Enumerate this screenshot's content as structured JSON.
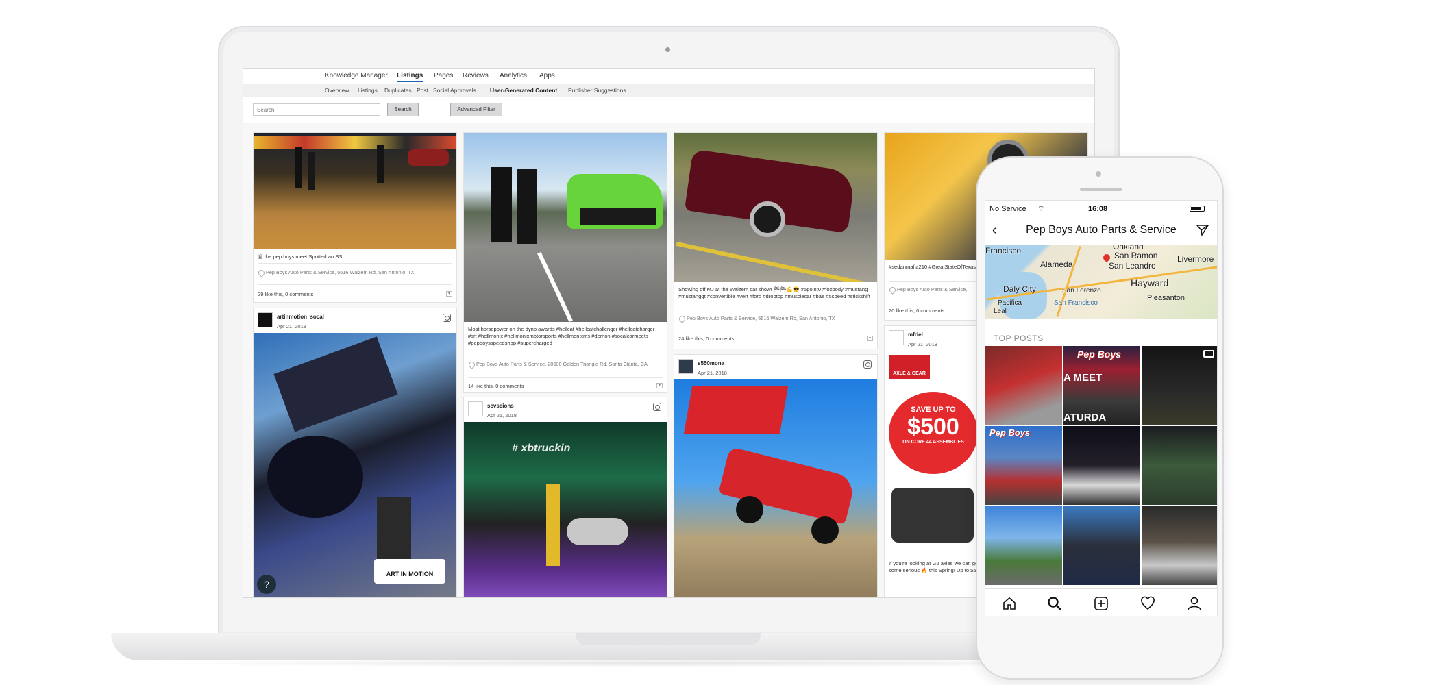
{
  "laptop": {
    "topnav": [
      "Knowledge Manager",
      "Listings",
      "Pages",
      "Reviews",
      "Analytics",
      "Apps"
    ],
    "subnav": [
      "Overview",
      "Listings",
      "Duplicates",
      "Post",
      "Social Approvals",
      "User-Generated Content",
      "Publisher Suggestions"
    ],
    "search_placeholder": "Search",
    "search_button": "Search",
    "advanced_button": "Advanced Filter",
    "help": "?",
    "posts": [
      {
        "caption": "@ the pep boys meet Spotted an SS",
        "location": "Pep Boys Auto Parts & Service, 5616 Walzem Rd, San Antonio, TX",
        "likes": "29 like this, 0 comments"
      },
      {
        "user": "artinmotion_socal",
        "date": "Apr 21, 2018"
      },
      {
        "caption": "Most horsepower on the dyno awards #hellcat #hellcatchallenger #hellcatcharger #srt #hellmonix #hellmonixmotorsports #hellmonixms #demon #socalcarmeets #pepboysspeedshop #supercharged",
        "location": "Pep Boys Auto Parts & Service, 20600 Golden Triangle Rd, Santa Clarita, CA",
        "likes": "14 like this, 0 comments"
      },
      {
        "user": "scvscions",
        "date": "Apr 21, 2018"
      },
      {
        "caption": "Showing off MJ at the Walzem car show! 🏁🏁💪😎 #5point0 #foxbody #mustang #mustanggt #convertible #vert #ford #droptop #musclecar #bae #5speed #stickshift",
        "location": "Pep Boys Auto Parts & Service, 5616 Walzem Rd, San Antonio, TX",
        "likes": "24 like this, 0 comments"
      },
      {
        "user": "s550mona",
        "date": "Apr 21, 2018"
      },
      {
        "caption": "#sedanmafia210 #GreatStateOfTexas #Snow300Mopar",
        "location": "Pep Boys Auto Parts & Service,",
        "likes": "20 like this, 0 comments"
      },
      {
        "user": "mfriel",
        "date": "Apr 21, 2018"
      },
      {
        "caption": "If you're looking at G2 axles we can get you G2 Axle & Gear + Smittybilt have the 2 some serious 🔥 this Spring! Up to $500 GEN2 winches. Order yours today d"
      }
    ],
    "ad": {
      "brand": "AXLE & GEAR",
      "save": "SAVE UP TO",
      "amount": "$500",
      "sub": "ON CORE 44 ASSEMBLIES"
    },
    "watermark": "ART IN MOTION",
    "hood_text": "# xbtruckin"
  },
  "phone": {
    "carrier": "No Service",
    "time": "16:08",
    "title": "Pep Boys Auto Parts & Service",
    "map_labels": [
      "Francisco",
      "Oakland",
      "San Ramon",
      "Alameda",
      "San Leandro",
      "Livermore",
      "Daly City",
      "Hayward",
      "San Lorenzo",
      "Pacifica",
      "San Francisco",
      "Pleasanton",
      "Leal"
    ],
    "top_posts_label": "TOP POSTS",
    "tile_texts": [
      "Pep Boys",
      "A MEET",
      "ATURDA",
      "Pep Boys"
    ]
  },
  "colors": {
    "accent": "#1b64b8",
    "green_car": "#6fd43a",
    "red_car": "#d7262b",
    "purple": "#7b3fa8"
  }
}
